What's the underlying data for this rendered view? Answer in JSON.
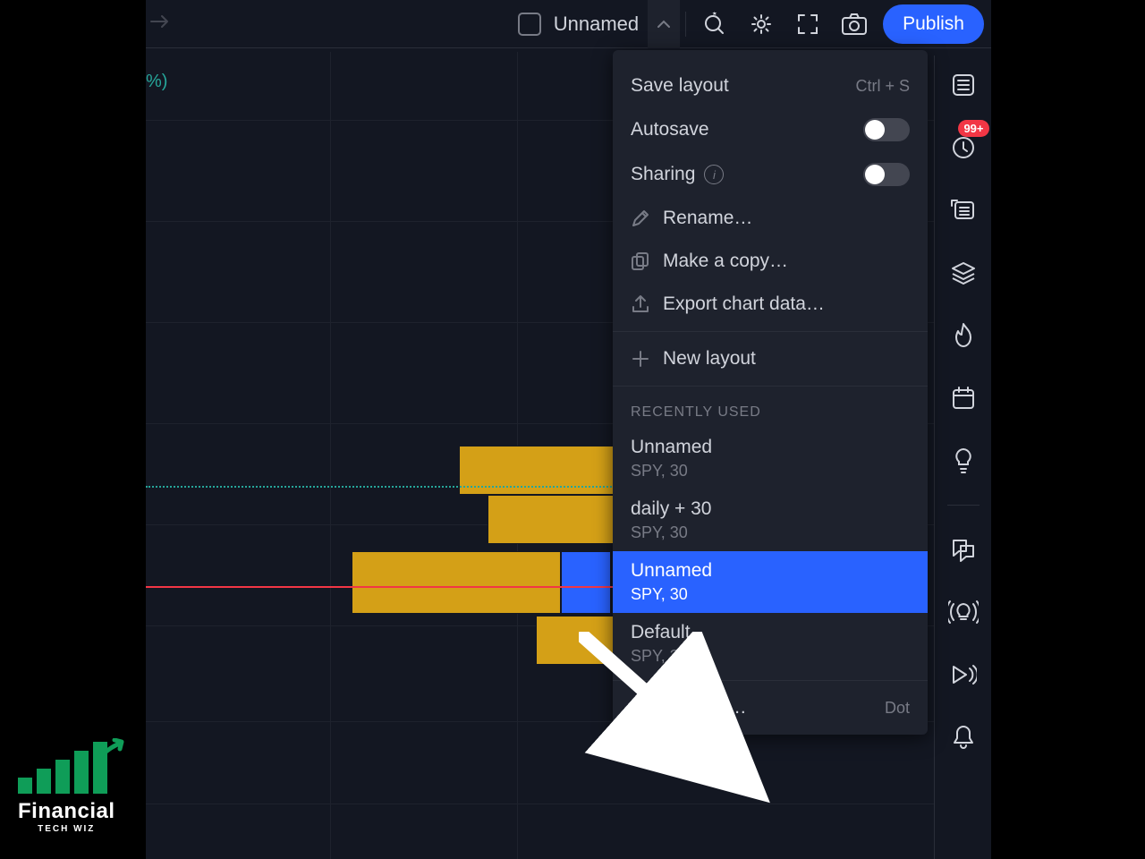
{
  "topbar": {
    "layout_name": "Unnamed",
    "publish_label": "Publish"
  },
  "charthint": {
    "pct_suffix": "%)"
  },
  "menu": {
    "save_layout": "Save layout",
    "save_shortcut": "Ctrl + S",
    "autosave": "Autosave",
    "sharing": "Sharing",
    "rename": "Rename…",
    "make_copy": "Make a copy…",
    "export_data": "Export chart data…",
    "new_layout": "New layout",
    "recently_used": "RECENTLY USED",
    "load_layout": "Load layout…",
    "load_shortcut": "Dot",
    "recent": [
      {
        "title": "Unnamed",
        "sub": "SPY, 30",
        "selected": false
      },
      {
        "title": "daily + 30",
        "sub": "SPY, 30",
        "selected": false
      },
      {
        "title": "Unnamed",
        "sub": "SPY, 30",
        "selected": true
      },
      {
        "title": "Default",
        "sub": "SPY, 30",
        "selected": false
      }
    ]
  },
  "rail": {
    "badge": "99+"
  },
  "logo": {
    "big": "Financial",
    "sub": "TECH WIZ"
  }
}
